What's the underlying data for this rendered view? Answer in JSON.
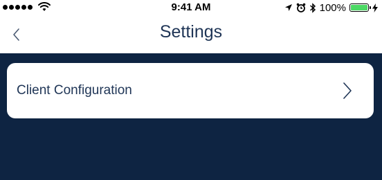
{
  "status_bar": {
    "time": "9:41 AM",
    "battery_percent": "100%",
    "battery_level": 1.0,
    "icons": [
      "signal-dots-icon",
      "wifi-icon",
      "location-arrow-icon",
      "alarm-icon",
      "bluetooth-icon",
      "battery-icon",
      "charging-bolt-icon"
    ]
  },
  "nav": {
    "title": "Settings",
    "back_icon": "chevron-left-icon"
  },
  "settings_items": [
    {
      "label": "Client Configuration",
      "icon": "chevron-right-icon"
    }
  ],
  "colors": {
    "background": "#0e2442",
    "title_text": "#1f3556",
    "battery_fill": "#4cd964",
    "surface": "#ffffff"
  }
}
